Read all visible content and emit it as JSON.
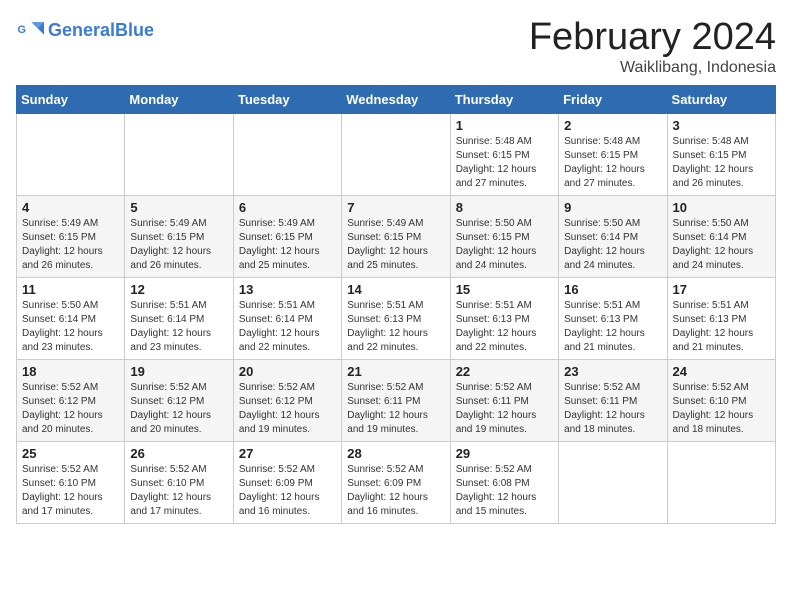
{
  "header": {
    "logo_general": "General",
    "logo_blue": "Blue",
    "title": "February 2024",
    "subtitle": "Waiklibang, Indonesia"
  },
  "days_of_week": [
    "Sunday",
    "Monday",
    "Tuesday",
    "Wednesday",
    "Thursday",
    "Friday",
    "Saturday"
  ],
  "weeks": [
    [
      {
        "day": "",
        "info": ""
      },
      {
        "day": "",
        "info": ""
      },
      {
        "day": "",
        "info": ""
      },
      {
        "day": "",
        "info": ""
      },
      {
        "day": "1",
        "info": "Sunrise: 5:48 AM\nSunset: 6:15 PM\nDaylight: 12 hours\nand 27 minutes."
      },
      {
        "day": "2",
        "info": "Sunrise: 5:48 AM\nSunset: 6:15 PM\nDaylight: 12 hours\nand 27 minutes."
      },
      {
        "day": "3",
        "info": "Sunrise: 5:48 AM\nSunset: 6:15 PM\nDaylight: 12 hours\nand 26 minutes."
      }
    ],
    [
      {
        "day": "4",
        "info": "Sunrise: 5:49 AM\nSunset: 6:15 PM\nDaylight: 12 hours\nand 26 minutes."
      },
      {
        "day": "5",
        "info": "Sunrise: 5:49 AM\nSunset: 6:15 PM\nDaylight: 12 hours\nand 26 minutes."
      },
      {
        "day": "6",
        "info": "Sunrise: 5:49 AM\nSunset: 6:15 PM\nDaylight: 12 hours\nand 25 minutes."
      },
      {
        "day": "7",
        "info": "Sunrise: 5:49 AM\nSunset: 6:15 PM\nDaylight: 12 hours\nand 25 minutes."
      },
      {
        "day": "8",
        "info": "Sunrise: 5:50 AM\nSunset: 6:15 PM\nDaylight: 12 hours\nand 24 minutes."
      },
      {
        "day": "9",
        "info": "Sunrise: 5:50 AM\nSunset: 6:14 PM\nDaylight: 12 hours\nand 24 minutes."
      },
      {
        "day": "10",
        "info": "Sunrise: 5:50 AM\nSunset: 6:14 PM\nDaylight: 12 hours\nand 24 minutes."
      }
    ],
    [
      {
        "day": "11",
        "info": "Sunrise: 5:50 AM\nSunset: 6:14 PM\nDaylight: 12 hours\nand 23 minutes."
      },
      {
        "day": "12",
        "info": "Sunrise: 5:51 AM\nSunset: 6:14 PM\nDaylight: 12 hours\nand 23 minutes."
      },
      {
        "day": "13",
        "info": "Sunrise: 5:51 AM\nSunset: 6:14 PM\nDaylight: 12 hours\nand 22 minutes."
      },
      {
        "day": "14",
        "info": "Sunrise: 5:51 AM\nSunset: 6:13 PM\nDaylight: 12 hours\nand 22 minutes."
      },
      {
        "day": "15",
        "info": "Sunrise: 5:51 AM\nSunset: 6:13 PM\nDaylight: 12 hours\nand 22 minutes."
      },
      {
        "day": "16",
        "info": "Sunrise: 5:51 AM\nSunset: 6:13 PM\nDaylight: 12 hours\nand 21 minutes."
      },
      {
        "day": "17",
        "info": "Sunrise: 5:51 AM\nSunset: 6:13 PM\nDaylight: 12 hours\nand 21 minutes."
      }
    ],
    [
      {
        "day": "18",
        "info": "Sunrise: 5:52 AM\nSunset: 6:12 PM\nDaylight: 12 hours\nand 20 minutes."
      },
      {
        "day": "19",
        "info": "Sunrise: 5:52 AM\nSunset: 6:12 PM\nDaylight: 12 hours\nand 20 minutes."
      },
      {
        "day": "20",
        "info": "Sunrise: 5:52 AM\nSunset: 6:12 PM\nDaylight: 12 hours\nand 19 minutes."
      },
      {
        "day": "21",
        "info": "Sunrise: 5:52 AM\nSunset: 6:11 PM\nDaylight: 12 hours\nand 19 minutes."
      },
      {
        "day": "22",
        "info": "Sunrise: 5:52 AM\nSunset: 6:11 PM\nDaylight: 12 hours\nand 19 minutes."
      },
      {
        "day": "23",
        "info": "Sunrise: 5:52 AM\nSunset: 6:11 PM\nDaylight: 12 hours\nand 18 minutes."
      },
      {
        "day": "24",
        "info": "Sunrise: 5:52 AM\nSunset: 6:10 PM\nDaylight: 12 hours\nand 18 minutes."
      }
    ],
    [
      {
        "day": "25",
        "info": "Sunrise: 5:52 AM\nSunset: 6:10 PM\nDaylight: 12 hours\nand 17 minutes."
      },
      {
        "day": "26",
        "info": "Sunrise: 5:52 AM\nSunset: 6:10 PM\nDaylight: 12 hours\nand 17 minutes."
      },
      {
        "day": "27",
        "info": "Sunrise: 5:52 AM\nSunset: 6:09 PM\nDaylight: 12 hours\nand 16 minutes."
      },
      {
        "day": "28",
        "info": "Sunrise: 5:52 AM\nSunset: 6:09 PM\nDaylight: 12 hours\nand 16 minutes."
      },
      {
        "day": "29",
        "info": "Sunrise: 5:52 AM\nSunset: 6:08 PM\nDaylight: 12 hours\nand 15 minutes."
      },
      {
        "day": "",
        "info": ""
      },
      {
        "day": "",
        "info": ""
      }
    ]
  ]
}
